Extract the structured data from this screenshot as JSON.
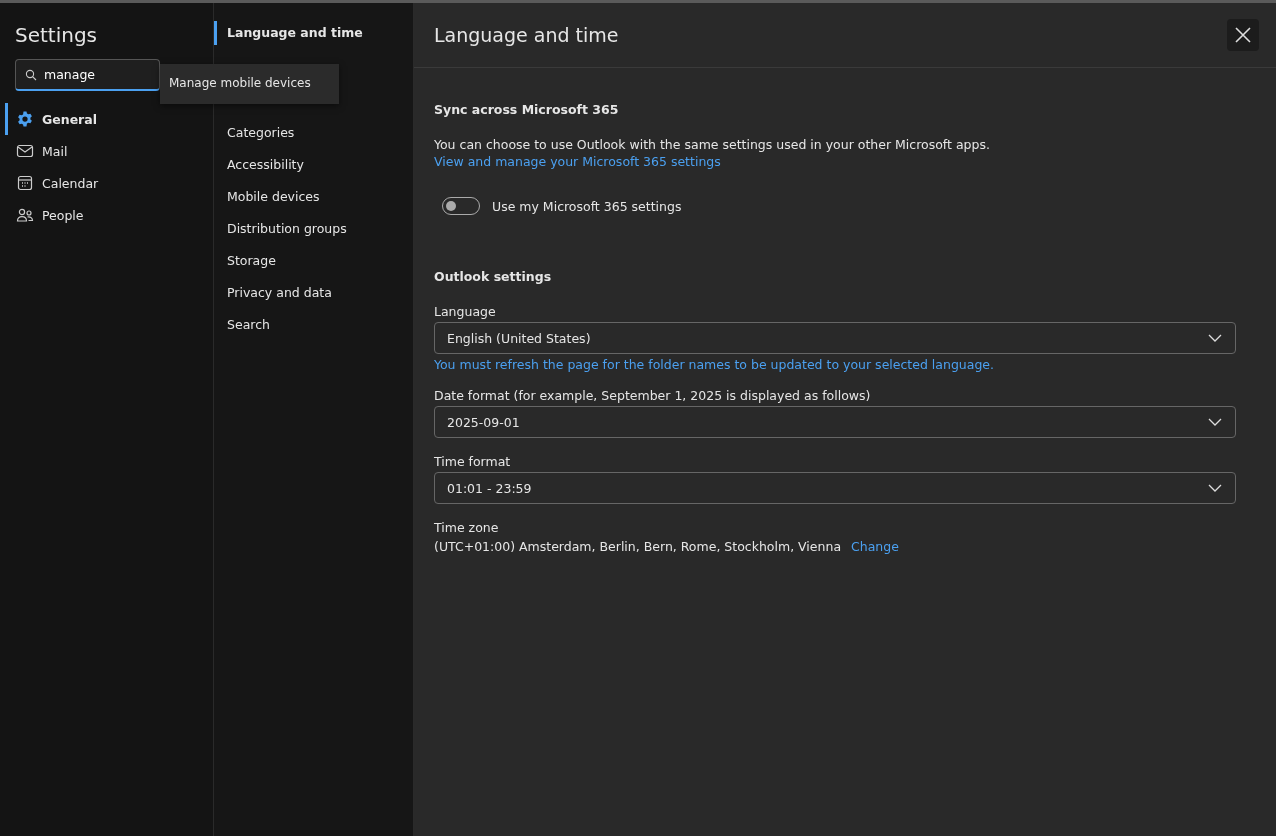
{
  "sidebar": {
    "title": "Settings",
    "search": {
      "value": "manage"
    },
    "suggestion": "Manage mobile devices",
    "items": [
      {
        "label": "General",
        "selected": true
      },
      {
        "label": "Mail",
        "selected": false
      },
      {
        "label": "Calendar",
        "selected": false
      },
      {
        "label": "People",
        "selected": false
      }
    ]
  },
  "subnav": {
    "items": [
      {
        "label": "Language and time",
        "selected": true
      },
      {
        "label": "Categories",
        "selected": false
      },
      {
        "label": "Accessibility",
        "selected": false
      },
      {
        "label": "Mobile devices",
        "selected": false
      },
      {
        "label": "Distribution groups",
        "selected": false
      },
      {
        "label": "Storage",
        "selected": false
      },
      {
        "label": "Privacy and data",
        "selected": false
      },
      {
        "label": "Search",
        "selected": false
      }
    ]
  },
  "panel": {
    "title": "Language and time",
    "sync": {
      "heading": "Sync across Microsoft 365",
      "text": "You can choose to use Outlook with the same settings used in your other Microsoft apps.",
      "link": "View and manage your Microsoft 365 settings",
      "toggle": {
        "label": "Use my Microsoft 365 settings",
        "on": false
      }
    },
    "outlook": {
      "heading": "Outlook settings",
      "fields": [
        {
          "label": "Language",
          "value": "English (United States)",
          "note": "You must refresh the page for the folder names to be updated to your selected language."
        },
        {
          "label": "Date format (for example, September 1, 2025 is displayed as follows)",
          "value": "2025-09-01"
        },
        {
          "label": "Time format",
          "value": "01:01 - 23:59"
        }
      ],
      "timezone": {
        "label": "Time zone",
        "value": "(UTC+01:00) Amsterdam, Berlin, Bern, Rome, Stockholm, Vienna",
        "link": "Change"
      }
    }
  }
}
